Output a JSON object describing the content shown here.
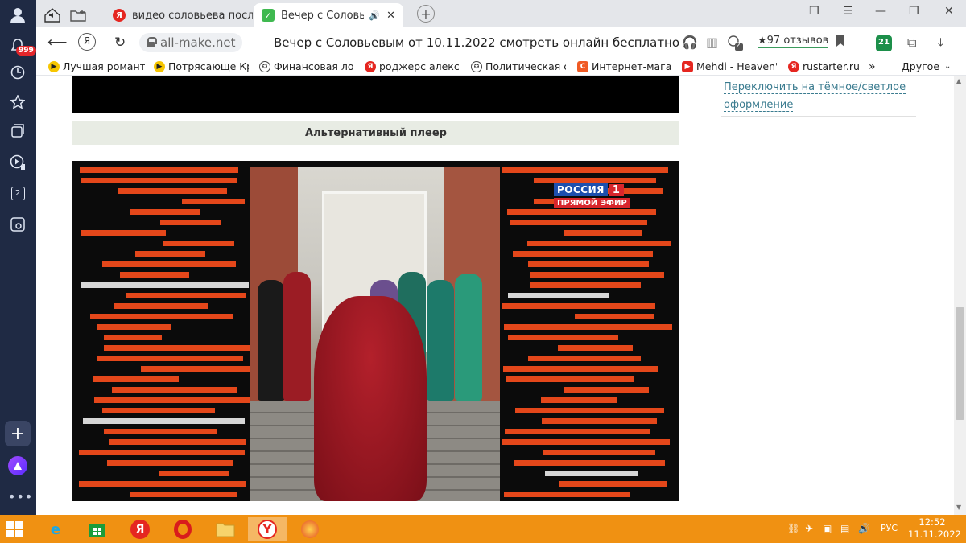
{
  "sidebar": {
    "notification_badge": "999",
    "tab_count": "2",
    "add_label": "+",
    "more_label": "•••"
  },
  "tabs": [
    {
      "label": "видео соловьева последн",
      "icon": "yandex-icon"
    },
    {
      "label": "Вечер с Соловьевым",
      "icon": "check-icon",
      "active": true
    }
  ],
  "address_bar": {
    "ya_button": "Я",
    "url": "all-make.net",
    "page_title": "Вечер с Соловьевым от 10.11.2022 смотреть онлайн бесплатно",
    "protect_badge": "2",
    "reviews": "★97 отзывов",
    "collections_badge": "21"
  },
  "bookmarks": [
    {
      "label": "Лучшая романтич",
      "icon": "play"
    },
    {
      "label": "Потрясающе Крас",
      "icon": "play"
    },
    {
      "label": "Финансовая ловуш",
      "icon": "ok"
    },
    {
      "label": "роджерс александ",
      "icon": "ya"
    },
    {
      "label": "Политическая ска",
      "icon": "ok"
    },
    {
      "label": "Интернет-магазин",
      "icon": "or"
    },
    {
      "label": "Mehdi - Heaven's",
      "icon": "yt"
    },
    {
      "label": "rustarter.ru –",
      "icon": "ya"
    }
  ],
  "bookmarks_more": "»",
  "bookmarks_other": "Другое",
  "content": {
    "alt_player_label": "Альтернативный плеер",
    "theme_toggle": "Переключить на тёмное/светлое оформление",
    "channel_name": "РОССИЯ",
    "channel_number": "1",
    "channel_live": "ПРЯМОЙ ЭФИР"
  },
  "taskbar": {
    "language": "РУС",
    "time": "12:52",
    "date": "11.11.2022"
  },
  "colors": {
    "sidebar_bg": "#1f2a44",
    "taskbar_bg": "#f09112",
    "stripe_orange": "#e4471a",
    "link": "#3a7b8f"
  }
}
